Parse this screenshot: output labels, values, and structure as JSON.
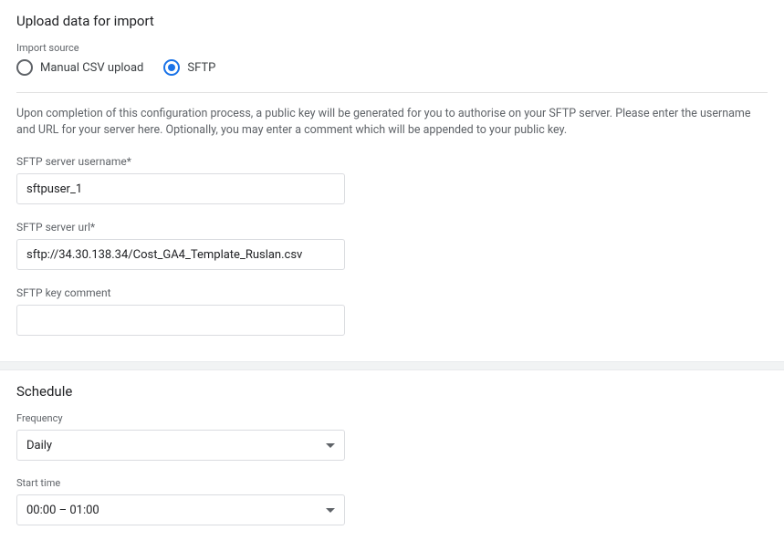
{
  "upload": {
    "title": "Upload data for import",
    "import_source_label": "Import source",
    "radio_manual": "Manual CSV upload",
    "radio_sftp": "SFTP",
    "selected": "sftp",
    "description": "Upon completion of this configuration process, a public key will be generated for you to authorise on your SFTP server. Please enter the username and URL for your server here. Optionally, you may enter a comment which will be appended to your public key.",
    "username_label": "SFTP server username*",
    "username_value": "sftpuser_1",
    "url_label": "SFTP server url*",
    "url_value": "sftp://34.30.138.34/Cost_GA4_Template_Ruslan.csv",
    "comment_label": "SFTP key comment",
    "comment_value": ""
  },
  "schedule": {
    "title": "Schedule",
    "frequency_label": "Frequency",
    "frequency_value": "Daily",
    "start_time_label": "Start time",
    "start_time_value": "00:00 – 01:00"
  }
}
